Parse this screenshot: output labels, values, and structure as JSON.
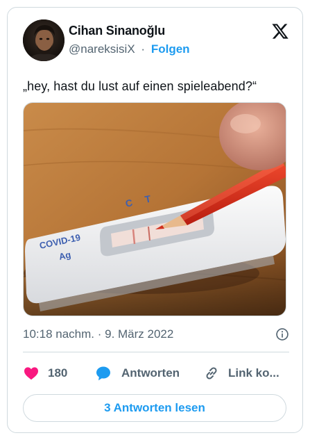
{
  "author": {
    "display_name": "Cihan Sinanoğlu",
    "handle": "@nareksisiX",
    "separator": "·",
    "follow_label": "Folgen"
  },
  "tweet": {
    "text": "„hey, hast du lust auf einen spieleabend?“",
    "image_text": {
      "test_label_line1": "COVID-19",
      "test_label_line2": "Ag",
      "marker_c": "C",
      "marker_t": "T"
    },
    "timestamp": "10:18 nachm. · 9. März 2022"
  },
  "actions": {
    "like_count": "180",
    "reply_label": "Antworten",
    "link_label": "Link ko..."
  },
  "footer": {
    "read_replies_label": "3 Antworten lesen"
  },
  "icons": {
    "logo": "x-logo-icon",
    "info": "info-icon",
    "like": "heart-icon",
    "reply": "speech-bubble-icon",
    "link": "link-icon"
  },
  "colors": {
    "accent": "#1d9bf0",
    "like": "#f91880",
    "text_primary": "#0f1419",
    "text_secondary": "#536471",
    "border": "#cfd9de"
  }
}
